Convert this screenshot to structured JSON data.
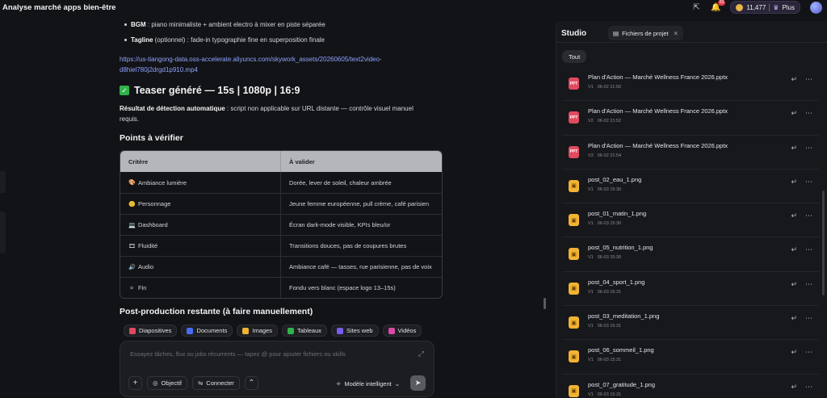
{
  "app": {
    "title": "Analyse marché apps bien-être"
  },
  "topbar": {
    "credits": "11,477",
    "plus_label": "Plus",
    "notifications": "53"
  },
  "chat": {
    "bullets": [
      {
        "label": "BGM",
        "text": " : piano minimaliste + ambient electro à mixer en piste séparée"
      },
      {
        "label": "Tagline",
        "text": " (optionnel) : fade-in typographie fine en superposition finale"
      }
    ],
    "link_line1": "https://us-tiangong-data.oss-accelerate.aliyuncs.com/skywork_assets/20260605/text2video-",
    "link_line2": "d8hiel780j2drgd1p910.mp4",
    "teaser_heading": "Teaser généré — 15s | 1080p | 16:9",
    "detect_label": "Résultat de détection automatique",
    "detect_text": " : script non applicable sur URL distante — contrôle visuel manuel requis.",
    "points_heading": "Points à vérifier",
    "table": {
      "headers": [
        "Critère",
        "À valider"
      ],
      "rows": [
        {
          "icon": "palette-icon",
          "glyph": "🎨",
          "criterion": "Ambiance lumière",
          "check": "Dorée, lever de soleil, chaleur ambrée"
        },
        {
          "icon": "person-icon",
          "glyph": "🙂",
          "criterion": "Personnage",
          "check": "Jeune femme européenne, pull crème, café parisien"
        },
        {
          "icon": "laptop-icon",
          "glyph": "💻",
          "criterion": "Dashboard",
          "check": "Écran dark-mode visible, KPIs bleu/or"
        },
        {
          "icon": "film-icon",
          "glyph": "🎞",
          "criterion": "Fluidité",
          "check": "Transitions douces, pas de coupures brutes"
        },
        {
          "icon": "speaker-icon",
          "glyph": "🔊",
          "criterion": "Audio",
          "check": "Ambiance café — tasses, rue parisienne, pas de voix"
        },
        {
          "icon": "circle-icon",
          "glyph": "⚪",
          "criterion": "Fin",
          "check": "Fondu vers blanc (espace logo 13–15s)"
        }
      ]
    },
    "postprod_heading": "Post-production restante (à faire manuellement)"
  },
  "chips": [
    {
      "label": "Diapositives",
      "color": "#e04a5f",
      "icon": "slides-icon"
    },
    {
      "label": "Documents",
      "color": "#4a6cf0",
      "icon": "document-icon"
    },
    {
      "label": "Images",
      "color": "#f2b233",
      "icon": "image-icon"
    },
    {
      "label": "Tableaux",
      "color": "#2fb34a",
      "icon": "table-icon"
    },
    {
      "label": "Sites web",
      "color": "#7a5cf0",
      "icon": "web-icon"
    },
    {
      "label": "Vidéos",
      "color": "#d94aa8",
      "icon": "video-icon"
    }
  ],
  "composer": {
    "placeholder": "Essayez tâches, flux ou jobs récurrents — tapez @ pour ajouter fichiers ou skills",
    "objectif_label": "Objectif",
    "connecter_label": "Connecter",
    "mode_label": "Modèle intelligent"
  },
  "studio": {
    "title": "Studio",
    "tab_label": "Fichiers de projet",
    "filter_label": "Tout",
    "files": [
      {
        "type": "pptx",
        "badge": "PPT",
        "name": "Plan d'Action — Marché Wellness France 2026.pptx",
        "version": "V1",
        "date": "06-02 21:50"
      },
      {
        "type": "pptx",
        "badge": "PPT",
        "name": "Plan d'Action — Marché Wellness France 2026.pptx",
        "version": "V2",
        "date": "06-02 21:52"
      },
      {
        "type": "pptx",
        "badge": "PPT",
        "name": "Plan d'Action — Marché Wellness France 2026.pptx",
        "version": "V3",
        "date": "06-02 21:54"
      },
      {
        "type": "png",
        "badge": "▣",
        "name": "post_02_eau_1.png",
        "version": "V1",
        "date": "06-03 15:30"
      },
      {
        "type": "png",
        "badge": "▣",
        "name": "post_01_matin_1.png",
        "version": "V1",
        "date": "06-03 15:30"
      },
      {
        "type": "png",
        "badge": "▣",
        "name": "post_05_nutrition_1.png",
        "version": "V1",
        "date": "06-03 15:30"
      },
      {
        "type": "png",
        "badge": "▣",
        "name": "post_04_sport_1.png",
        "version": "V1",
        "date": "06-03 15:31"
      },
      {
        "type": "png",
        "badge": "▣",
        "name": "post_03_meditation_1.png",
        "version": "V1",
        "date": "06-03 15:31"
      },
      {
        "type": "png",
        "badge": "▣",
        "name": "post_06_sommeil_1.png",
        "version": "V1",
        "date": "06-03 15:31"
      },
      {
        "type": "png",
        "badge": "▣",
        "name": "post_07_gratitude_1.png",
        "version": "V1",
        "date": "06-03 15:31"
      }
    ]
  }
}
